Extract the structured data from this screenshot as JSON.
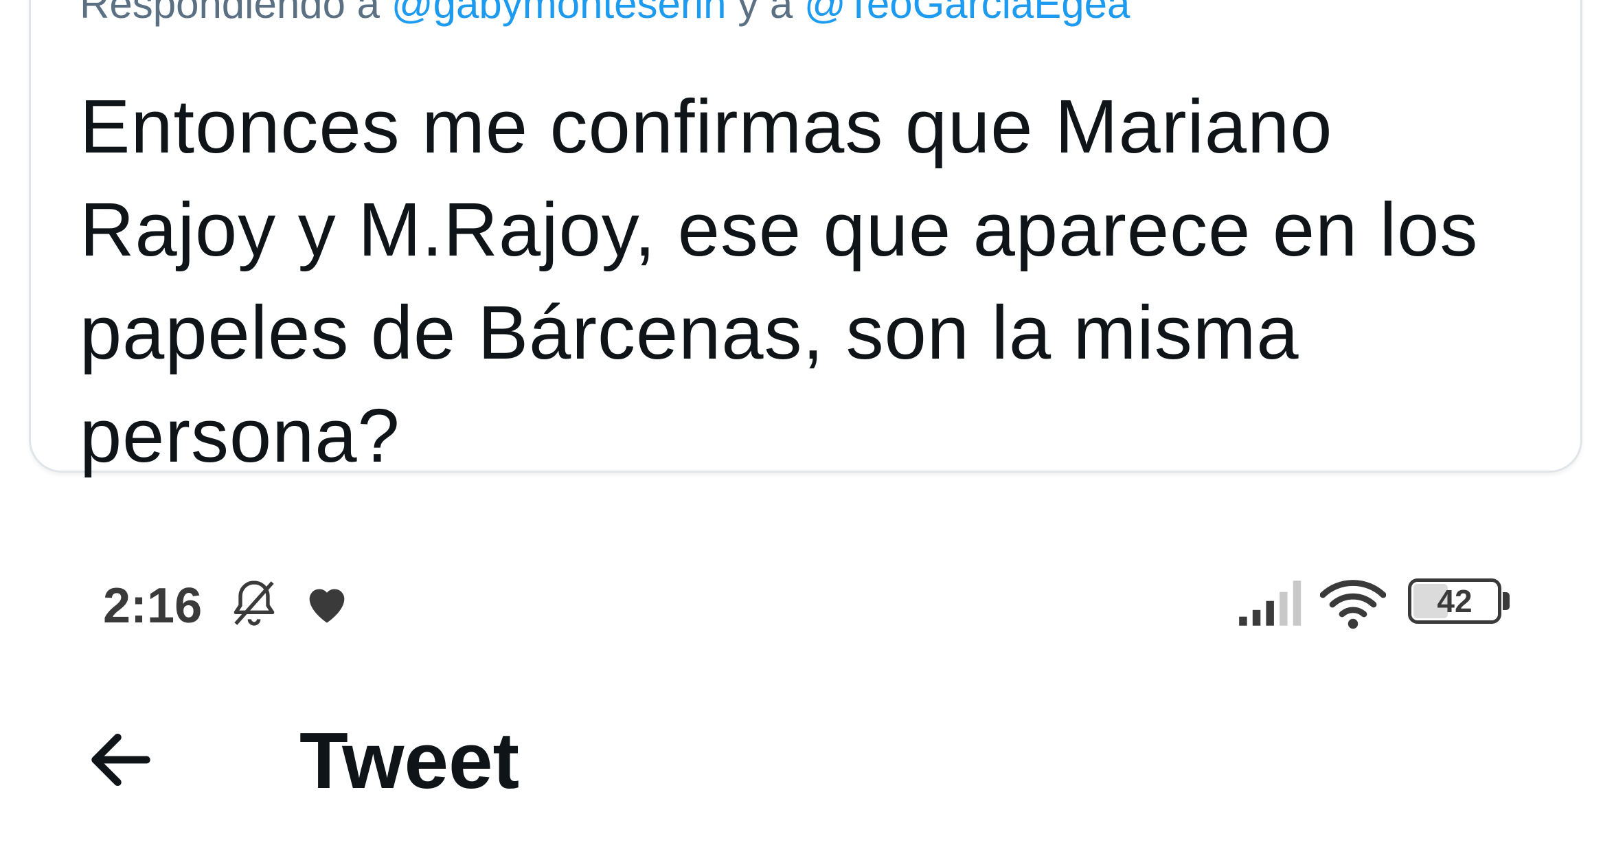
{
  "quoted_tweet": {
    "replying_prefix": "Respondiendo a ",
    "mention_1": "@gabymonteserin",
    "replying_joiner": " y a ",
    "mention_2": "@TeoGarciaEgea",
    "text": "Entonces me confirmas que Mariano\nRajoy y M.Rajoy, ese que aparece en los\npapeles de Bárcenas, son la misma\npersona?"
  },
  "status_bar": {
    "time": "2:16",
    "icons": [
      "bell-off-icon",
      "heart-icon",
      "signal-icon",
      "wifi-icon"
    ],
    "battery_level": "42",
    "battery_fraction": 0.42
  },
  "header": {
    "back_icon": "arrow-left-icon",
    "title": "Tweet"
  },
  "colors": {
    "mention": "#1d9bf0",
    "muted_text": "#5b7083",
    "primary_text": "#0f1419",
    "card_border": "#dfe5e9",
    "status_icons": "#3a3a3a"
  }
}
